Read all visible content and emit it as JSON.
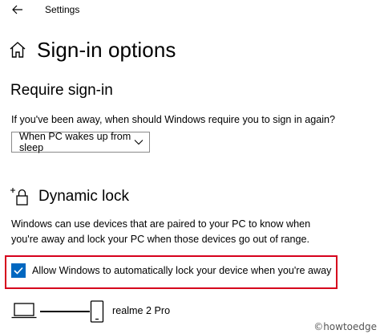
{
  "window": {
    "app_title": "Settings"
  },
  "page": {
    "title": "Sign-in options"
  },
  "require_signin": {
    "heading": "Require sign-in",
    "question": "If you've been away, when should Windows require you to sign in again?",
    "dropdown_value": "When PC wakes up from sleep"
  },
  "dynamic_lock": {
    "heading": "Dynamic lock",
    "description_line1": "Windows can use devices that are paired to your PC to know when",
    "description_line2": "you're away and lock your PC when those devices go out of range.",
    "checkbox_label": "Allow Windows to automatically lock your device when you're away",
    "checkbox_checked": true,
    "paired_device_name": "realme 2 Pro"
  },
  "watermark": "©howtoedge",
  "colors": {
    "accent": "#0067c0",
    "highlight_border": "#d6001c",
    "text": "#000000",
    "background": "#ffffff"
  },
  "icons": {
    "back": "arrow-left-icon",
    "home": "home-icon",
    "dropdown": "chevron-down-icon",
    "dynamic_lock": "lock-sparkle-icon",
    "checkbox": "checkmark-icon",
    "pc": "laptop-icon",
    "device": "phone-icon"
  }
}
